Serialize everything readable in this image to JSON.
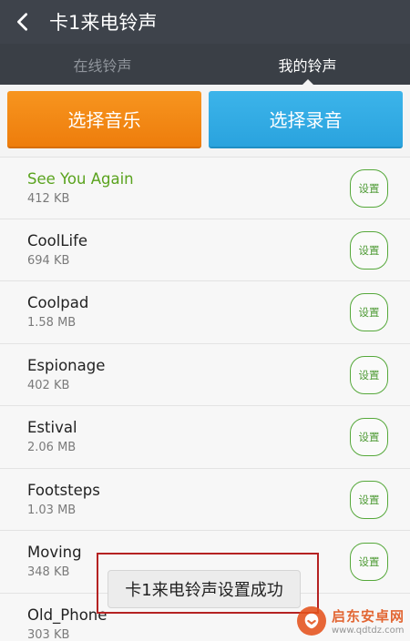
{
  "header": {
    "title": "卡1来电铃声"
  },
  "tabs": [
    {
      "label": "在线铃声",
      "active": false
    },
    {
      "label": "我的铃声",
      "active": true
    }
  ],
  "actions": {
    "choose_music": "选择音乐",
    "choose_recording": "选择录音"
  },
  "ringtones": [
    {
      "name": "See You Again",
      "size": "412 KB",
      "set_label": "设置",
      "current": true
    },
    {
      "name": "CoolLife",
      "size": "694 KB",
      "set_label": "设置",
      "current": false
    },
    {
      "name": "Coolpad",
      "size": "1.58 MB",
      "set_label": "设置",
      "current": false
    },
    {
      "name": "Espionage",
      "size": "402 KB",
      "set_label": "设置",
      "current": false
    },
    {
      "name": "Estival",
      "size": "2.06 MB",
      "set_label": "设置",
      "current": false
    },
    {
      "name": "Footsteps",
      "size": "1.03 MB",
      "set_label": "设置",
      "current": false
    },
    {
      "name": "Moving",
      "size": "348 KB",
      "set_label": "设置",
      "current": false
    },
    {
      "name": "Old_Phone",
      "size": "303 KB",
      "set_label": "",
      "current": false
    }
  ],
  "toast": {
    "message": "卡1来电铃声设置成功"
  },
  "watermark": {
    "name": "启东安卓网",
    "url": "www.qdtdz.com"
  },
  "colors": {
    "header": "#3e434b",
    "orange": "#f39016",
    "blue": "#33abe4",
    "green": "#55a83a",
    "highlight": "#b52222"
  }
}
